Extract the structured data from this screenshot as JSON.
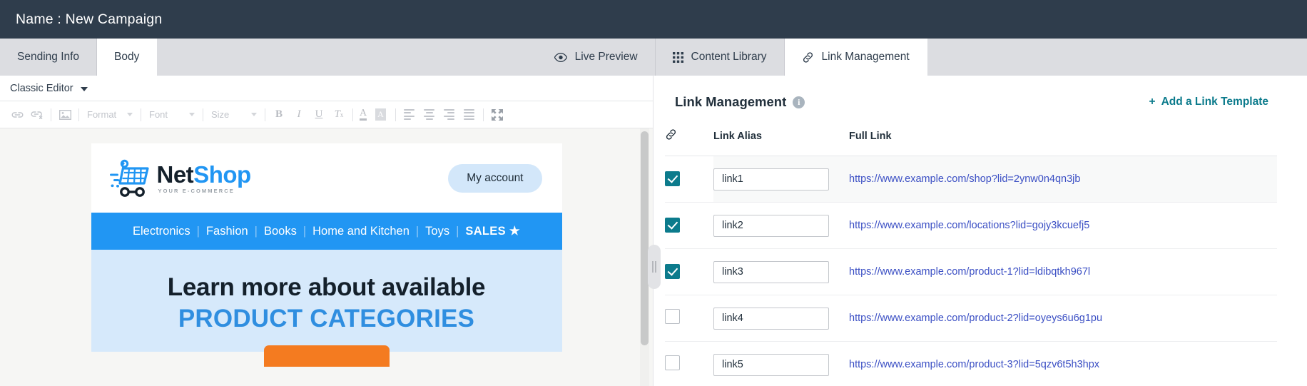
{
  "titlebar": {
    "text": "Name : New Campaign"
  },
  "tabs": {
    "left": [
      {
        "label": "Sending Info",
        "active": false
      },
      {
        "label": "Body",
        "active": true
      }
    ],
    "right": [
      {
        "label": "Live Preview",
        "icon": "eye-icon",
        "active": false
      },
      {
        "label": "Content Library",
        "icon": "grid-icon",
        "active": false
      },
      {
        "label": "Link Management",
        "icon": "link-icon",
        "active": true
      }
    ]
  },
  "editor": {
    "mode_label": "Classic Editor",
    "toolbar": {
      "link": "link-icon",
      "unlink": "unlink-icon",
      "image": "image-icon",
      "format_label": "Format",
      "font_label": "Font",
      "size_label": "Size",
      "bold": "B",
      "italic": "I",
      "underline": "U",
      "remove_format": "Tx",
      "text_color": "A",
      "bg_color": "A",
      "maximize": "maximize-icon"
    }
  },
  "email": {
    "logo": {
      "name_part1": "Net",
      "name_part2": "Shop",
      "tagline": "YOUR E-COMMERCE"
    },
    "account_button": "My account",
    "nav": [
      "Electronics",
      "Fashion",
      "Books",
      "Home and Kitchen",
      "Toys"
    ],
    "nav_sales": "SALES",
    "nav_sales_star": "★",
    "hero_line1": "Learn more about available",
    "hero_line2": "PRODUCT CATEGORIES"
  },
  "link_management": {
    "title": "Link Management",
    "info_icon": "info-icon",
    "add_template_plus": "+",
    "add_template_label": "Add a Link Template",
    "columns": {
      "check_icon": "link-icon",
      "alias": "Link Alias",
      "full_link": "Full Link"
    },
    "rows": [
      {
        "checked": true,
        "alias": "link1",
        "url": "https://www.example.com/shop?lid=2ynw0n4qn3jb"
      },
      {
        "checked": true,
        "alias": "link2",
        "url": "https://www.example.com/locations?lid=gojy3kcuefj5"
      },
      {
        "checked": true,
        "alias": "link3",
        "url": "https://www.example.com/product-1?lid=ldibqtkh967l"
      },
      {
        "checked": false,
        "alias": "link4",
        "url": "https://www.example.com/product-2?lid=oyeys6u6g1pu"
      },
      {
        "checked": false,
        "alias": "link5",
        "url": "https://www.example.com/product-3?lid=5qzv6t5h3hpx"
      }
    ]
  },
  "colors": {
    "titlebar_bg": "#2f3d4c",
    "tabstrip_bg": "#dcdde1",
    "accent_teal": "#0c7b8c",
    "link_blue": "#3b4fc4",
    "brand_blue": "#2196f3",
    "hero_bg": "#d6e9fb",
    "cta_orange": "#f47b20"
  }
}
